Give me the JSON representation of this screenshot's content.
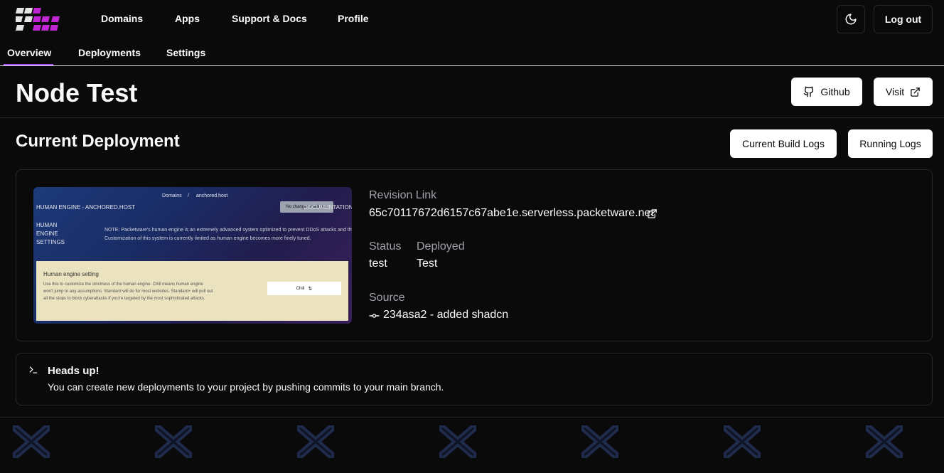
{
  "nav": {
    "links": [
      "Domains",
      "Apps",
      "Support & Docs",
      "Profile"
    ],
    "logout_label": "Log out",
    "theme_icon": "moon-icon"
  },
  "tabs": [
    "Overview",
    "Deployments",
    "Settings"
  ],
  "active_tab": "Overview",
  "project": {
    "title": "Node Test",
    "github_label": "Github",
    "visit_label": "Visit"
  },
  "deployment": {
    "section_title": "Current Deployment",
    "build_logs_label": "Current Build Logs",
    "running_logs_label": "Running Logs",
    "revision_label": "Revision Link",
    "revision_url": "65c70117672d6157c67abe1e.serverless.packetware.net",
    "status_label": "Status",
    "status_value": "test",
    "deployed_label": "Deployed",
    "deployed_value": "Test",
    "source_label": "Source",
    "source_value": "234asa2 - added shadcn"
  },
  "preview": {
    "breadcrumb_a": "Domains",
    "breadcrumb_sep": "/",
    "breadcrumb_b": "anchored.host",
    "header": "HUMAN ENGINE - ANCHORED.HOST",
    "chip": "No changes made yet",
    "docs": "DOCUMENTATION",
    "side_1": "HUMAN",
    "side_2": "ENGINE",
    "side_3": "SETTINGS",
    "note": "NOTE: Packetware's human engine is an extremely advanced system optimized to prevent DDoS attacks and thwart bots. Customization of this system is currently limited as human engine becomes more finely tuned.",
    "panel_title": "Human engine setting",
    "panel_desc": "Use this to customize the strictness of the human engine. Chill means human engine won't jump to any assumptions. Standard will do for most websites. Standard+ will pull out all the stops to block cyberattacks if you're targeted by the most sophisticated attacks.",
    "select_value": "Chill"
  },
  "alert": {
    "title": "Heads up!",
    "description": "You can create new deployments to your project by pushing commits to your main branch.",
    "icon": "terminal-icon"
  },
  "colors": {
    "accent": "#a855f7",
    "background": "#0a0a0b",
    "border": "#27272a"
  }
}
